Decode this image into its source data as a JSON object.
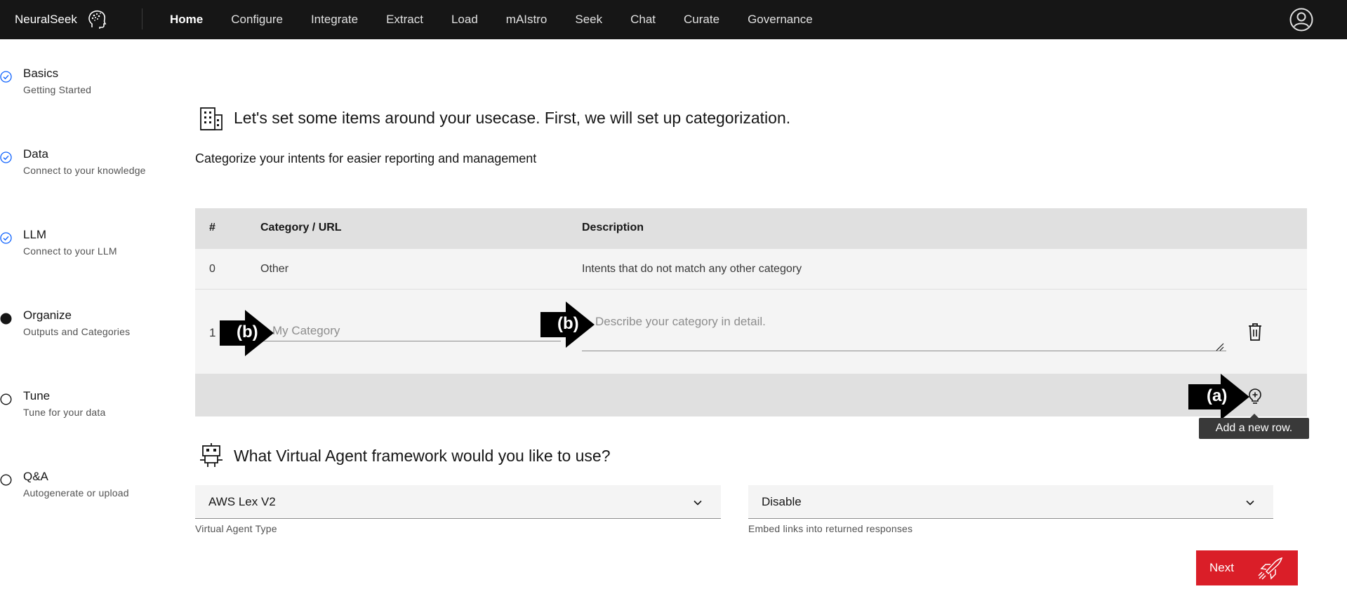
{
  "nav": {
    "brand": "NeuralSeek",
    "items": [
      {
        "label": "Home",
        "active": true
      },
      {
        "label": "Configure"
      },
      {
        "label": "Integrate"
      },
      {
        "label": "Extract"
      },
      {
        "label": "Load"
      },
      {
        "label": "mAIstro"
      },
      {
        "label": "Seek"
      },
      {
        "label": "Chat"
      },
      {
        "label": "Curate"
      },
      {
        "label": "Governance"
      }
    ],
    "user_icon": "user-avatar-icon"
  },
  "steps": [
    {
      "title": "Basics",
      "subtitle": "Getting Started",
      "state": "complete"
    },
    {
      "title": "Data",
      "subtitle": "Connect to your knowledge",
      "state": "complete"
    },
    {
      "title": "LLM",
      "subtitle": "Connect to your LLM",
      "state": "complete"
    },
    {
      "title": "Organize",
      "subtitle": "Outputs and Categories",
      "state": "current"
    },
    {
      "title": "Tune",
      "subtitle": "Tune for your data",
      "state": "incomplete"
    },
    {
      "title": "Q&A",
      "subtitle": "Autogenerate or upload",
      "state": "incomplete"
    }
  ],
  "categorization": {
    "heading": "Let's set some items around your usecase. First, we will set up categorization.",
    "subheading": "Categorize your intents for easier reporting and management",
    "columns": [
      "#",
      "Category / URL",
      "Description"
    ],
    "rows": [
      {
        "num": "0",
        "category": "Other",
        "description": "Intents that do not match any other category"
      }
    ],
    "new_row": {
      "num": "1",
      "category_value": "",
      "category_placeholder": "My Category",
      "description_value": "",
      "description_placeholder": "Describe your category in detail."
    },
    "add_row_tooltip": "Add a new row.",
    "annotations": [
      "(a)",
      "(b)",
      "(b)"
    ]
  },
  "virtual_agent": {
    "heading": "What Virtual Agent framework would you like to use?",
    "type_value": "AWS Lex V2",
    "type_helper": "Virtual Agent Type",
    "embed_value": "Disable",
    "embed_helper": "Embed links into returned responses"
  },
  "next_button": "Next",
  "colors": {
    "nav_bg": "#161616",
    "accent_blue": "#0f62fe",
    "next_red": "#da1e28"
  }
}
